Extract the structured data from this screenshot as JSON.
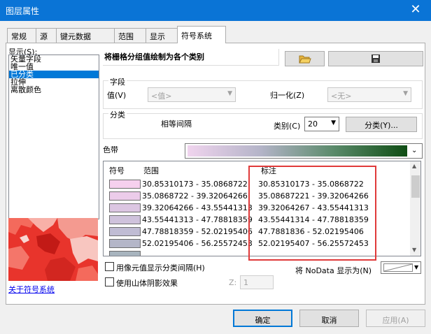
{
  "window": {
    "title": "图层属性",
    "close": "✕"
  },
  "tabs": [
    "常规",
    "源",
    "键元数据",
    "范围",
    "显示",
    "符号系统"
  ],
  "show_label": "显示(S):",
  "show_items": [
    "矢量字段",
    "唯一值",
    "已分类",
    "拉伸",
    "离散颜色"
  ],
  "selected_show_item": "已分类",
  "heading": "将栅格分组值绘制为各个类别",
  "fields": {
    "group_title": "字段",
    "value_label": "值(V)",
    "value_selected": "<值>",
    "normalize_label": "归一化(Z)",
    "normalize_selected": "<无>"
  },
  "classification": {
    "group_title": "分类",
    "method": "相等间隔",
    "classes_label": "类别(C)",
    "classes_value": "20",
    "classify_button": "分类(Y)..."
  },
  "color_ramp": {
    "label": "色带",
    "colors": [
      "#f0d4ee",
      "#b4b4c8",
      "#5a8a6a",
      "#0f4d14"
    ]
  },
  "table": {
    "headers": {
      "symbol": "符号",
      "range": "范围",
      "label": "标注"
    },
    "rows": [
      {
        "color": "#f6d0ee",
        "range": "30.85310173 - 35.0868722",
        "label": "30.85310173 - 35.0868722"
      },
      {
        "color": "#ecccea",
        "range": "35.0868722 - 39.32064266",
        "label": "35.08687221 - 39.32064266"
      },
      {
        "color": "#dcc6e2",
        "range": "39.32064266 - 43.55441313",
        "label": "39.32064267 - 43.55441313"
      },
      {
        "color": "#cfc2dc",
        "range": "43.55441313 - 47.78818359",
        "label": "43.55441314 - 47.78818359"
      },
      {
        "color": "#c0bcd4",
        "range": "47.78818359 - 52.02195406",
        "label": "47.7881836 - 52.02195406"
      },
      {
        "color": "#b4b6c8",
        "range": "52.02195406 - 56.25572453",
        "label": "52.02195407 - 56.25572453"
      },
      {
        "color": "#a8b4be",
        "range": "",
        "label": ""
      }
    ]
  },
  "options": {
    "show_class_breaks": "用像元值显示分类间隔(H)",
    "hillshade": "使用山体阴影效果",
    "z_label": "Z:",
    "z_value": "1",
    "nodata_label": "将 NoData 显示为(N)"
  },
  "about_link": "关于符号系统",
  "buttons": {
    "ok": "确定",
    "cancel": "取消",
    "apply": "应用(A)"
  }
}
